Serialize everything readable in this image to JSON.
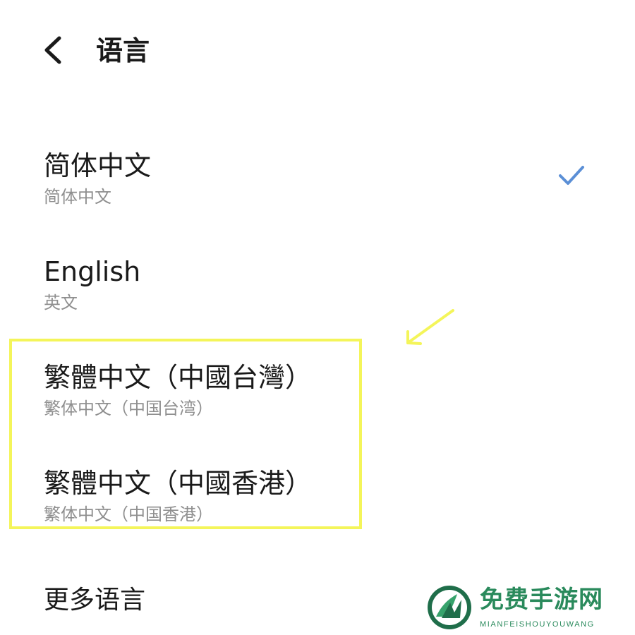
{
  "header": {
    "back_icon": "chevron-left-icon",
    "title": "语言"
  },
  "languages": [
    {
      "name": "简体中文",
      "subtitle": "简体中文",
      "selected": true
    },
    {
      "name": "English",
      "subtitle": "英文",
      "selected": false
    },
    {
      "name": "繁體中文（中國台灣）",
      "subtitle": "繁体中文（中国台湾）",
      "selected": false
    },
    {
      "name": "繁體中文（中國香港）",
      "subtitle": "繁体中文（中国香港）",
      "selected": false
    }
  ],
  "more_languages": "更多语言",
  "selected_icon": "checkmark-icon",
  "annotation": {
    "highlight_color": "#f4f55a",
    "arrow_icon": "arrow-down-left-icon"
  },
  "watermark": {
    "title": "免费手游网",
    "subtitle": "MIANFEISHOUYOUWANG",
    "color": "#2a8a5c"
  },
  "colors": {
    "check": "#5b8fd6",
    "primary_text": "#1a1a1a",
    "secondary_text": "#8f8f8f"
  }
}
